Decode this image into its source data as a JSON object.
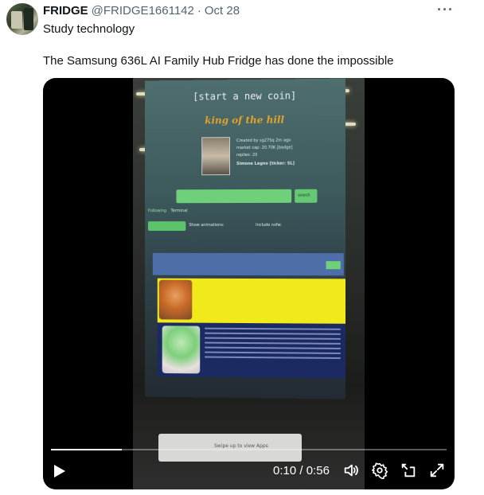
{
  "tweet": {
    "author_name": "FRIDGE",
    "author_handle": "@FRIDGE1661142",
    "separator": "·",
    "date": "Oct 28",
    "subtitle": "Study technology",
    "text": "The Samsung 636L AI Family Hub Fridge has done the impossible",
    "more_label": "···"
  },
  "video": {
    "current_time": "0:10",
    "duration": "0:56",
    "time_separator": " / ",
    "progress_fraction": 0.1786,
    "screen": {
      "start_new_coin": "[start a new coin]",
      "king_of_the_hill": "king of the hill",
      "created_by": "Created by  sg27Sq  2m ago",
      "market_cap": "market cap: 20.70K [badge]",
      "replies": "replies: 20",
      "coin_name": "Simone Legno [ticker: SL]",
      "search_label": "search",
      "tab_following": "Following",
      "tab_terminal": "Terminal",
      "show_animations": "Show animations:",
      "include_nsfw": "Include nsfw:",
      "swipe_text": "Swipe up to view Apps"
    },
    "icons": [
      "play-icon",
      "volume-icon",
      "settings-icon",
      "pip-icon",
      "fullscreen-icon"
    ]
  }
}
